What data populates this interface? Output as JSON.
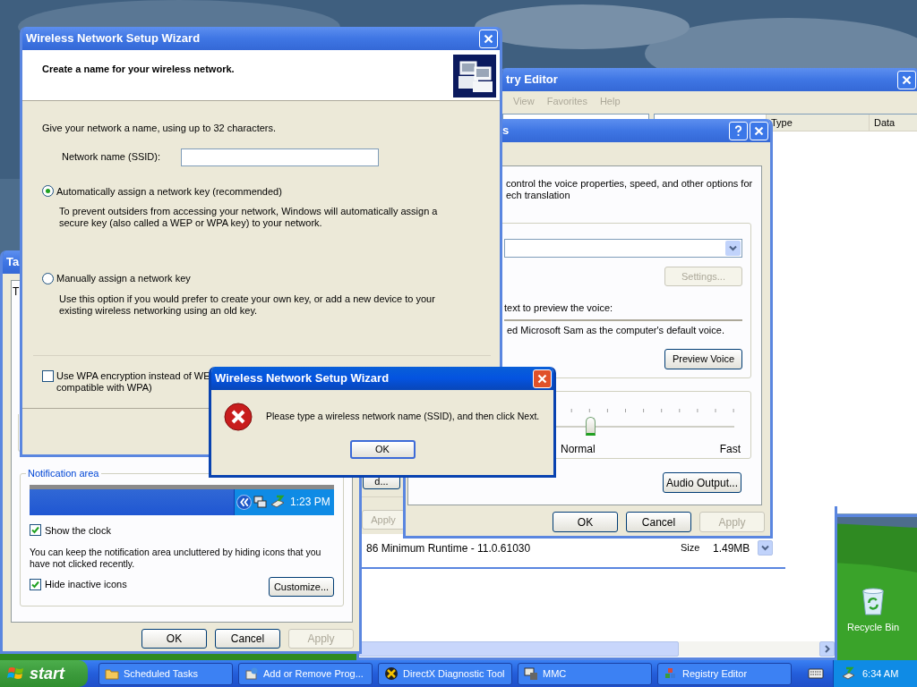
{
  "desktop": {
    "icons": [
      {
        "label": "Recycle Bin"
      }
    ]
  },
  "registry_editor": {
    "title": "try Editor",
    "active": false,
    "menu": [
      "View",
      "Favorites",
      "Help"
    ],
    "columns": [
      "Type",
      "Data"
    ]
  },
  "add_remove_programs": {
    "program": "86 Minimum Runtime - 11.0.61030",
    "size_label": "Size",
    "size": "1.49MB"
  },
  "background_dialog": {
    "buttons": [
      {
        "label": "d...",
        "disabled": false
      },
      {
        "label": "Apply",
        "disabled": true
      }
    ]
  },
  "speech_properties": {
    "title": "s",
    "active": false,
    "intro": "control the voice properties, speed, and other options for\nech translation",
    "settings_button": {
      "label": "Settings...",
      "disabled": true
    },
    "preview_label": "text to preview the voice:",
    "preview_text": "ed Microsoft Sam as the computer's default voice.",
    "preview_button": {
      "label": "Preview Voice",
      "disabled": false
    },
    "speed": {
      "level": 0.5,
      "labels": [
        "Normal",
        "Fast"
      ]
    },
    "audio_output_button": {
      "label": "Audio Output...",
      "disabled": false
    },
    "buttons": [
      {
        "label": "OK",
        "disabled": false
      },
      {
        "label": "Cancel",
        "disabled": false
      },
      {
        "label": "Apply",
        "disabled": true
      }
    ]
  },
  "taskbar_properties": {
    "title": "Ta",
    "active": false,
    "tab": "T",
    "group_title": "Notification area",
    "preview_clock": "1:23 PM",
    "show_clock": {
      "label": "Show the clock",
      "checked": true
    },
    "note": "You can keep the notification area uncluttered by hiding icons that you\nhave not clicked recently.",
    "hide_inactive": {
      "label": "Hide inactive icons",
      "checked": true
    },
    "customize_button": {
      "label": "Customize...",
      "disabled": false
    },
    "buttons": [
      {
        "label": "OK",
        "disabled": false
      },
      {
        "label": "Cancel",
        "disabled": false
      },
      {
        "label": "Apply",
        "disabled": true
      }
    ]
  },
  "wizard": {
    "title": "Wireless Network Setup Wizard",
    "active": false,
    "heading": "Create a name for your wireless network.",
    "intro": "Give your network a name, using up to 32 characters.",
    "ssid_label": "Network name (SSID):",
    "key_options": [
      {
        "label": "Automatically assign a network key (recommended)",
        "selected": true,
        "description": "To prevent outsiders from accessing your network, Windows will automatically assign a\nsecure key (also called a WEP or WPA key) to your network."
      },
      {
        "label": "Manually assign a network key",
        "selected": false,
        "description": "Use this option if you would prefer to create your own key, or add a new device to your\nexisting wireless networking using an old key."
      }
    ],
    "wpa": {
      "label": "Use WPA encryption instead of WE\ncompatible with WPA)",
      "checked": false
    }
  },
  "error_dialog": {
    "title": "Wireless Network Setup Wizard",
    "active": true,
    "message": "Please type a wireless network name (SSID), and then click Next.",
    "button": "OK"
  },
  "taskbar": {
    "start": "start",
    "items": [
      {
        "label": "Scheduled Tasks",
        "kind": "folder"
      },
      {
        "label": "Add or Remove Prog...",
        "kind": "box"
      },
      {
        "label": "DirectX Diagnostic Tool",
        "kind": "directx"
      },
      {
        "label": "MMC",
        "kind": "console"
      },
      {
        "label": "Registry Editor",
        "kind": "cubes"
      }
    ],
    "clock": "6:34 AM"
  }
}
